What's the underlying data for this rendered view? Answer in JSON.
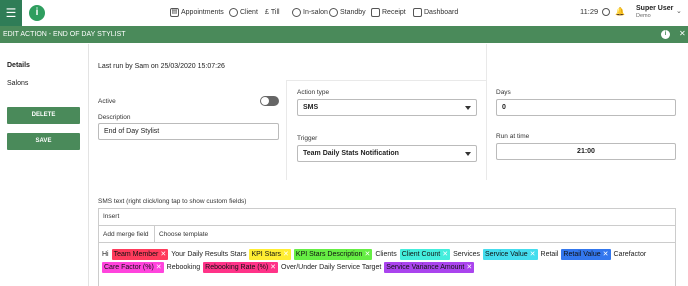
{
  "topnav": {
    "items": [
      {
        "label": "Appointments",
        "icon": "calendar-icon"
      },
      {
        "label": "Client",
        "icon": "person-icon"
      },
      {
        "label": "Till",
        "icon": "pound-icon"
      },
      {
        "label": "In-salon",
        "icon": "hand-icon"
      },
      {
        "label": "Standby",
        "icon": "timer-icon"
      },
      {
        "label": "Receipt",
        "icon": "printer-icon"
      },
      {
        "label": "Dashboard",
        "icon": "dashboard-icon"
      }
    ],
    "time": "11:29",
    "user_name": "Super User",
    "user_sub": "Demo"
  },
  "header": {
    "title": "EDIT ACTION - END OF DAY STYLIST"
  },
  "sidebar": {
    "items": [
      "Details",
      "Salons"
    ],
    "delete_label": "DELETE",
    "save_label": "SAVE"
  },
  "form": {
    "last_run": "Last run by Sam on 25/03/2020 15:07:26",
    "active_label": "Active",
    "description_label": "Description",
    "description_value": "End of Day Stylist",
    "action_type_label": "Action type",
    "action_type_value": "SMS",
    "trigger_label": "Trigger",
    "trigger_value": "Team Daily Stats Notification",
    "days_label": "Days",
    "days_value": "0",
    "run_at_label": "Run at time",
    "run_at_value": "21:00"
  },
  "sms": {
    "label": "SMS text (right click/long tap to show custom fields)",
    "insert_label": "Insert",
    "add_merge_label": "Add merge field",
    "choose_template_label": "Choose template",
    "tokens_line1": [
      {
        "text": "Hi"
      },
      {
        "text": "Team Member",
        "chip": "#ff3b5c"
      },
      {
        "text": "Your Daily Results Stars"
      },
      {
        "text": "KPI Stars",
        "chip": "#ffee33"
      },
      {
        "text": "KPI Stars Description",
        "chip": "#66ee44"
      },
      {
        "text": "Clients"
      },
      {
        "text": "Client Count",
        "chip": "#44eedd"
      },
      {
        "text": "Services"
      },
      {
        "text": "Service Value",
        "chip": "#44ddee"
      },
      {
        "text": "Retail"
      },
      {
        "text": "Retail Value",
        "chip": "#3377ee"
      },
      {
        "text": "Carefactor"
      }
    ],
    "tokens_line2": [
      {
        "text": "Care Factor (%)",
        "chip": "#ff44dd"
      },
      {
        "text": "Rebooking"
      },
      {
        "text": "Rebooking Rate (%)",
        "chip": "#ff3388"
      },
      {
        "text": "Over/Under Daily Service Target"
      },
      {
        "text": "Service Variance Amount",
        "chip": "#aa44ee"
      }
    ]
  }
}
